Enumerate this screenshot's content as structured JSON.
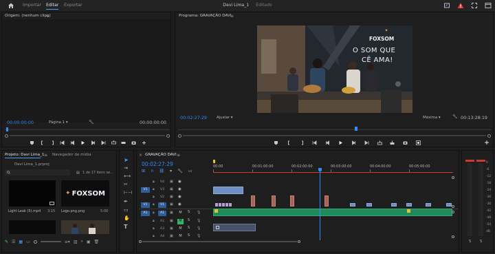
{
  "topbar": {
    "tabs": [
      "Importar",
      "Editar",
      "Exportar"
    ],
    "active_tab": "Editar",
    "title": "Davi Lima_1",
    "status": "Editado"
  },
  "source": {
    "title": "Origem: (nenhum clipe)",
    "timecode_in": "00:00:00:00",
    "page": "Página 1",
    "timecode_out": "00:00:00:00"
  },
  "program": {
    "title": "Programa: GRAVAÇÃO DAVI",
    "timecode": "00:02:27:29",
    "fit": "Ajustar",
    "quality": "Máxima",
    "duration": "00:13:28:19",
    "video": {
      "logo": "FOXSOM",
      "wall_line1": "O SOM QUE",
      "wall_line2": "CÊ AMA!"
    }
  },
  "project": {
    "tab_project": "Projeto: Davi Lima_1",
    "tab_media": "Navegador de mídia",
    "file": "Davi Lima_1.prproj",
    "count": "1 de 17 itens se...",
    "items": [
      {
        "name": "Light Leak (5).mp4",
        "dur": "3:15"
      },
      {
        "name": "Logo.png.png",
        "dur": "5:00"
      }
    ],
    "logo_text": "FOXSOM"
  },
  "timeline": {
    "sequence": "GRAVAÇÃO DAVI",
    "timecode": "00:02:27:29",
    "ruler": [
      "00:00",
      "00:01:00:00",
      "00:02:00:00",
      "00:03:00:00",
      "00:04:00:00",
      "00:05:00:00"
    ],
    "video_tracks": [
      "V4",
      "V3",
      "V2",
      "V1"
    ],
    "audio_tracks": [
      "A1",
      "A2",
      "A3",
      "A4"
    ],
    "mute": "M",
    "solo": "S",
    "targets": [
      "V1",
      "A1"
    ]
  },
  "meter": {
    "scale": [
      "0",
      "-6",
      "-12",
      "-18",
      "-24",
      "-30",
      "-36",
      "-42",
      "-48",
      "-54",
      "dB"
    ],
    "channels": [
      "S",
      "S"
    ]
  },
  "colors": {
    "accent": "#2f8bff",
    "playhead": "#2f8bff",
    "audio_clip": "#1f8a5a",
    "video_clip": "#6f8fc4",
    "peak": "#d0392b"
  }
}
